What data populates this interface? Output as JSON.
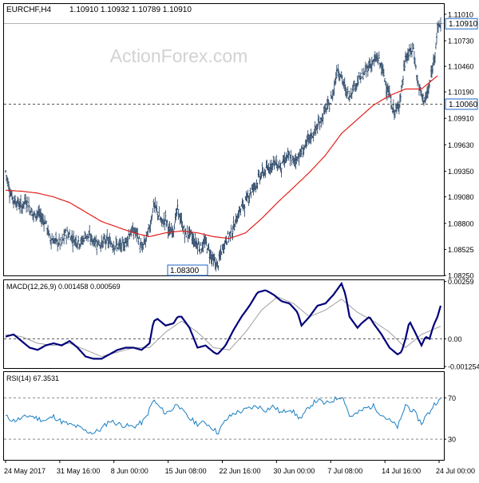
{
  "header": {
    "symbol": "EURCHF,H4",
    "ohlc": "1.10910 1.10932 1.10789 1.10910"
  },
  "watermark": "ActionForex.com",
  "colors": {
    "background": "#ffffff",
    "bars": "#1c3a5c",
    "moving_average": "#e2211c",
    "macd_line": "#00007a",
    "macd_signal": "#a0a0a0",
    "rsi_line": "#1b7fc4",
    "tag_border": "#1b64c8",
    "grid_dash": "#555555",
    "watermark": "#d2d2d2",
    "text": "#000000"
  },
  "price_panel": {
    "ylim": [
      1.0825,
      1.1111
    ],
    "price_ticks": [
      "1.11010",
      "1.10730",
      "1.10460",
      "1.10190",
      "1.09910",
      "1.09630",
      "1.09350",
      "1.09080",
      "1.08800",
      "1.08525",
      "1.08250"
    ],
    "current_price": {
      "label": "1.10910",
      "value": 1.1091
    },
    "level_line": {
      "label": "1.10060",
      "value": 1.1006
    },
    "low_annotation": {
      "label": "1.08300",
      "value": 1.083
    }
  },
  "macd_panel": {
    "label": "MACD(12,26,9) 0.001458 0.000569",
    "ylim": [
      -0.00132,
      0.00265
    ],
    "ticks": [
      "0.00259",
      "0.00",
      "-0.001254"
    ]
  },
  "rsi_panel": {
    "label": "RSI(14) 67.3531",
    "ylim": [
      10,
      95
    ],
    "ticks": [
      "70",
      "30"
    ],
    "levels": [
      70,
      30
    ]
  },
  "x_axis": {
    "labels": [
      "24 May 2017",
      "31 May 16:00",
      "8 Jun 00:00",
      "15 Jun 08:00",
      "22 Jun 16:00",
      "30 Jun 00:00",
      "7 Jul 08:00",
      "14 Jul 16:00",
      "24 Jul 00:00"
    ]
  },
  "chart_data": [
    {
      "type": "ohlc",
      "series_name": "EURCHF,H4",
      "ylim": [
        1.0825,
        1.1111
      ],
      "x": [
        "24 May 2017",
        "31 May 16:00",
        "8 Jun 00:00",
        "15 Jun 08:00",
        "22 Jun 16:00",
        "30 Jun 00:00",
        "7 Jul 08:00",
        "14 Jul 16:00",
        "24 Jul 00:00"
      ],
      "close_path_approx": [
        [
          0,
          1.0935
        ],
        [
          5,
          1.0915
        ],
        [
          10,
          1.0905
        ],
        [
          15,
          1.0902
        ],
        [
          20,
          1.0897
        ],
        [
          25,
          1.0905
        ],
        [
          30,
          1.0897
        ],
        [
          35,
          1.0888
        ],
        [
          40,
          1.0892
        ],
        [
          45,
          1.0885
        ],
        [
          50,
          1.0882
        ],
        [
          55,
          1.0865
        ],
        [
          60,
          1.0862
        ],
        [
          65,
          1.086
        ],
        [
          70,
          1.0858
        ],
        [
          75,
          1.087
        ],
        [
          80,
          1.0868
        ],
        [
          85,
          1.0863
        ],
        [
          90,
          1.0862
        ],
        [
          95,
          1.086
        ],
        [
          100,
          1.0868
        ],
        [
          105,
          1.0865
        ],
        [
          110,
          1.0862
        ],
        [
          115,
          1.086
        ],
        [
          120,
          1.0858
        ],
        [
          125,
          1.0862
        ],
        [
          130,
          1.086
        ],
        [
          135,
          1.0858
        ],
        [
          140,
          1.0856
        ],
        [
          145,
          1.0855
        ],
        [
          150,
          1.086
        ],
        [
          155,
          1.087
        ],
        [
          160,
          1.0872
        ],
        [
          165,
          1.0868
        ],
        [
          170,
          1.0852
        ],
        [
          175,
          1.0862
        ],
        [
          180,
          1.0875
        ],
        [
          185,
          1.09
        ],
        [
          190,
          1.0892
        ],
        [
          195,
          1.088
        ],
        [
          200,
          1.0885
        ],
        [
          205,
          1.087
        ],
        [
          210,
          1.0875
        ],
        [
          215,
          1.0895
        ],
        [
          220,
          1.088
        ],
        [
          225,
          1.0868
        ],
        [
          230,
          1.087
        ],
        [
          235,
          1.0862
        ],
        [
          240,
          1.0858
        ],
        [
          245,
          1.0855
        ],
        [
          250,
          1.086
        ],
        [
          255,
          1.085
        ],
        [
          260,
          1.084
        ],
        [
          265,
          1.0835
        ],
        [
          270,
          1.085
        ],
        [
          275,
          1.0862
        ],
        [
          280,
          1.0868
        ],
        [
          285,
          1.0875
        ],
        [
          290,
          1.0888
        ],
        [
          295,
          1.0897
        ],
        [
          300,
          1.0902
        ],
        [
          305,
          1.0912
        ],
        [
          310,
          1.0918
        ],
        [
          315,
          1.0925
        ],
        [
          320,
          1.0932
        ],
        [
          325,
          1.0935
        ],
        [
          330,
          1.094
        ],
        [
          335,
          1.0945
        ],
        [
          340,
          1.0942
        ],
        [
          345,
          1.094
        ],
        [
          350,
          1.0948
        ],
        [
          355,
          1.095
        ],
        [
          360,
          1.0945
        ],
        [
          365,
          1.095
        ],
        [
          370,
          1.0955
        ],
        [
          375,
          1.0962
        ],
        [
          380,
          1.097
        ],
        [
          385,
          1.0975
        ],
        [
          390,
          1.0982
        ],
        [
          395,
          1.099
        ],
        [
          400,
          1.1
        ],
        [
          405,
          1.1005
        ],
        [
          410,
          1.102
        ],
        [
          415,
          1.1045
        ],
        [
          420,
          1.1035
        ],
        [
          425,
          1.102
        ],
        [
          430,
          1.1015
        ],
        [
          435,
          1.1025
        ],
        [
          440,
          1.103
        ],
        [
          445,
          1.1035
        ],
        [
          450,
          1.104
        ],
        [
          455,
          1.1048
        ],
        [
          460,
          1.105
        ],
        [
          465,
          1.1055
        ],
        [
          470,
          1.1045
        ],
        [
          475,
          1.103
        ],
        [
          480,
          1.1015
        ],
        [
          485,
          1.0998
        ],
        [
          490,
          1.1
        ],
        [
          495,
          1.102
        ],
        [
          500,
          1.1055
        ],
        [
          505,
          1.106
        ],
        [
          510,
          1.1065
        ],
        [
          515,
          1.103
        ],
        [
          520,
          1.1015
        ],
        [
          525,
          1.101
        ],
        [
          530,
          1.1025
        ],
        [
          535,
          1.105
        ],
        [
          540,
          1.1085
        ],
        [
          544,
          1.1091
        ]
      ]
    },
    {
      "type": "line",
      "series_name": "moving average",
      "x_index_y": [
        [
          0,
          1.0915
        ],
        [
          20,
          1.0914
        ],
        [
          40,
          1.0912
        ],
        [
          60,
          1.0908
        ],
        [
          80,
          1.0902
        ],
        [
          100,
          1.0892
        ],
        [
          120,
          1.0882
        ],
        [
          140,
          1.0876
        ],
        [
          160,
          1.087
        ],
        [
          180,
          1.0866
        ],
        [
          200,
          1.087
        ],
        [
          220,
          1.0872
        ],
        [
          240,
          1.087
        ],
        [
          260,
          1.0866
        ],
        [
          280,
          1.0864
        ],
        [
          300,
          1.087
        ],
        [
          320,
          1.0885
        ],
        [
          340,
          1.0902
        ],
        [
          360,
          1.0918
        ],
        [
          380,
          1.0934
        ],
        [
          400,
          1.0952
        ],
        [
          420,
          1.0975
        ],
        [
          440,
          1.099
        ],
        [
          460,
          1.1005
        ],
        [
          480,
          1.1015
        ],
        [
          500,
          1.1022
        ],
        [
          520,
          1.1022
        ],
        [
          540,
          1.1036
        ]
      ]
    },
    {
      "type": "line",
      "series_name": "MACD(12,26,9)",
      "current": {
        "macd": 0.001458,
        "signal": 0.000569
      },
      "macd": [
        [
          0,
          0.0001
        ],
        [
          10,
          0.0002
        ],
        [
          20,
          -0.0001
        ],
        [
          30,
          -0.0004
        ],
        [
          40,
          -0.0005
        ],
        [
          50,
          -0.0003
        ],
        [
          60,
          -0.0002
        ],
        [
          70,
          -0.0003
        ],
        [
          80,
          -0.0001
        ],
        [
          90,
          -0.0004
        ],
        [
          100,
          -0.0008
        ],
        [
          110,
          -0.0009
        ],
        [
          120,
          -0.0009
        ],
        [
          130,
          -0.0007
        ],
        [
          140,
          -0.0005
        ],
        [
          150,
          -0.0004
        ],
        [
          160,
          -0.0004
        ],
        [
          170,
          -0.0005
        ],
        [
          180,
          -0.0002
        ],
        [
          185,
          0.0008
        ],
        [
          190,
          0.0009
        ],
        [
          200,
          0.0006
        ],
        [
          210,
          0.0007
        ],
        [
          215,
          0.001
        ],
        [
          220,
          0.001
        ],
        [
          230,
          0.0005
        ],
        [
          240,
          -0.0004
        ],
        [
          250,
          -0.0003
        ],
        [
          260,
          -0.0006
        ],
        [
          265,
          -0.0007
        ],
        [
          275,
          -0.0003
        ],
        [
          285,
          0.0004
        ],
        [
          295,
          0.001
        ],
        [
          305,
          0.0015
        ],
        [
          315,
          0.0021
        ],
        [
          325,
          0.0022
        ],
        [
          335,
          0.002
        ],
        [
          345,
          0.0017
        ],
        [
          355,
          0.0016
        ],
        [
          365,
          0.0012
        ],
        [
          370,
          0.0006
        ],
        [
          380,
          0.001
        ],
        [
          390,
          0.0015
        ],
        [
          400,
          0.0016
        ],
        [
          410,
          0.002
        ],
        [
          420,
          0.0025
        ],
        [
          425,
          0.002
        ],
        [
          430,
          0.001
        ],
        [
          440,
          0.0005
        ],
        [
          445,
          0.0007
        ],
        [
          455,
          0.001
        ],
        [
          460,
          0.0007
        ],
        [
          470,
          0.0002
        ],
        [
          480,
          -0.0004
        ],
        [
          490,
          -0.0007
        ],
        [
          495,
          -0.0006
        ],
        [
          500,
          0.0
        ],
        [
          505,
          0.0008
        ],
        [
          512,
          0.0003
        ],
        [
          520,
          -0.0003
        ],
        [
          525,
          0.0001
        ],
        [
          530,
          0.0
        ],
        [
          535,
          0.0006
        ],
        [
          540,
          0.001
        ],
        [
          544,
          0.0015
        ]
      ],
      "signal": [
        [
          0,
          0.0002
        ],
        [
          20,
          0.0001
        ],
        [
          40,
          -0.0002
        ],
        [
          60,
          -0.0003
        ],
        [
          80,
          -0.0002
        ],
        [
          100,
          -0.0005
        ],
        [
          120,
          -0.0008
        ],
        [
          140,
          -0.0006
        ],
        [
          160,
          -0.0004
        ],
        [
          180,
          -0.0004
        ],
        [
          200,
          0.0003
        ],
        [
          220,
          0.0008
        ],
        [
          240,
          0.0003
        ],
        [
          260,
          -0.0004
        ],
        [
          280,
          -0.0005
        ],
        [
          300,
          0.0003
        ],
        [
          320,
          0.0013
        ],
        [
          340,
          0.0019
        ],
        [
          360,
          0.0016
        ],
        [
          380,
          0.001
        ],
        [
          400,
          0.0013
        ],
        [
          420,
          0.0018
        ],
        [
          440,
          0.0012
        ],
        [
          460,
          0.0008
        ],
        [
          480,
          0.0003
        ],
        [
          500,
          -0.0004
        ],
        [
          520,
          0.0002
        ],
        [
          544,
          0.000569
        ]
      ]
    },
    {
      "type": "line",
      "series_name": "RSI(14)",
      "current": 67.3531,
      "values": [
        [
          0,
          52
        ],
        [
          10,
          48
        ],
        [
          20,
          50
        ],
        [
          30,
          53
        ],
        [
          40,
          50
        ],
        [
          50,
          48
        ],
        [
          60,
          52
        ],
        [
          70,
          47
        ],
        [
          80,
          44
        ],
        [
          90,
          42
        ],
        [
          100,
          38
        ],
        [
          110,
          36
        ],
        [
          120,
          40
        ],
        [
          130,
          48
        ],
        [
          140,
          45
        ],
        [
          150,
          43
        ],
        [
          160,
          42
        ],
        [
          170,
          46
        ],
        [
          175,
          50
        ],
        [
          185,
          68
        ],
        [
          190,
          63
        ],
        [
          200,
          55
        ],
        [
          210,
          60
        ],
        [
          215,
          66
        ],
        [
          220,
          58
        ],
        [
          230,
          50
        ],
        [
          240,
          45
        ],
        [
          250,
          46
        ],
        [
          260,
          40
        ],
        [
          265,
          36
        ],
        [
          275,
          48
        ],
        [
          285,
          55
        ],
        [
          295,
          57
        ],
        [
          305,
          60
        ],
        [
          315,
          62
        ],
        [
          325,
          58
        ],
        [
          335,
          62
        ],
        [
          345,
          55
        ],
        [
          355,
          60
        ],
        [
          365,
          52
        ],
        [
          370,
          50
        ],
        [
          380,
          62
        ],
        [
          390,
          68
        ],
        [
          400,
          64
        ],
        [
          410,
          68
        ],
        [
          420,
          72
        ],
        [
          425,
          65
        ],
        [
          430,
          52
        ],
        [
          440,
          55
        ],
        [
          450,
          60
        ],
        [
          460,
          62
        ],
        [
          470,
          54
        ],
        [
          480,
          48
        ],
        [
          490,
          42
        ],
        [
          495,
          50
        ],
        [
          500,
          64
        ],
        [
          505,
          60
        ],
        [
          512,
          55
        ],
        [
          520,
          45
        ],
        [
          525,
          52
        ],
        [
          530,
          56
        ],
        [
          535,
          63
        ],
        [
          540,
          67
        ],
        [
          544,
          67.35
        ]
      ]
    }
  ]
}
